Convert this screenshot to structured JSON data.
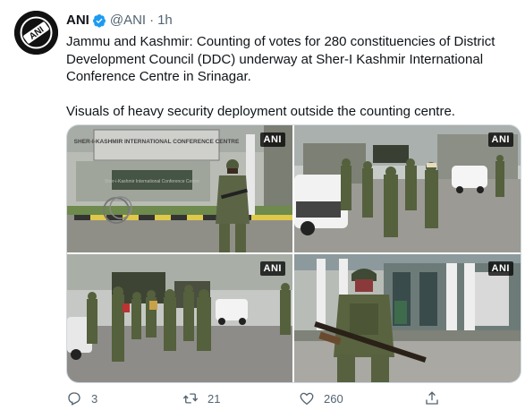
{
  "tweet": {
    "author_name": "ANI",
    "handle": "@ANI",
    "separator": "·",
    "time": "1h",
    "text_line1": "Jammu and Kashmir: Counting of votes for 280 constituencies of District Development Council (DDC) underway at Sher-I Kashmir International Conference Centre in Srinagar.",
    "text_line2": "Visuals of heavy security deployment outside the counting centre.",
    "avatar_text": "ANI"
  },
  "media": {
    "watermark": "ANI",
    "photo1_sign_title": "SHER-I-KASHMIR INTERNATIONAL CONFERENCE CENTRE",
    "photo1_sign_sub": "Sher-i-Kashmir International Conference Centre"
  },
  "actions": {
    "replies": "3",
    "retweets": "21",
    "likes": "260"
  },
  "colors": {
    "text": "#0f1419",
    "secondary": "#536471",
    "verified": "#1d9bf0"
  }
}
